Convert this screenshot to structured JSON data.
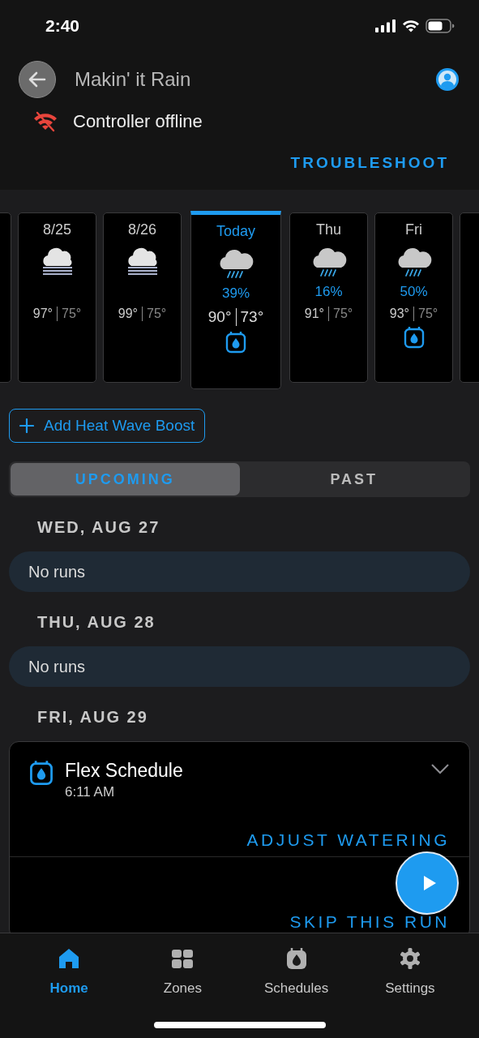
{
  "status_bar": {
    "time": "2:40"
  },
  "header": {
    "title": "Makin' it Rain",
    "status": "Controller offline",
    "action": "TROUBLESHOOT"
  },
  "forecast": [
    {
      "kind": "partial"
    },
    {
      "kind": "fog",
      "label": "8/25",
      "high": "97°",
      "low": "75°",
      "selected": false,
      "scheduled": false
    },
    {
      "kind": "fog",
      "label": "8/26",
      "high": "99°",
      "low": "75°",
      "selected": false,
      "scheduled": false
    },
    {
      "kind": "rain",
      "label": "Today",
      "chance": "39%",
      "high": "90°",
      "low": "73°",
      "selected": true,
      "scheduled": true
    },
    {
      "kind": "rain",
      "label": "Thu",
      "chance": "16%",
      "high": "91°",
      "low": "75°",
      "selected": false,
      "scheduled": false
    },
    {
      "kind": "rain",
      "label": "Fri",
      "chance": "50%",
      "high": "93°",
      "low": "75°",
      "selected": false,
      "scheduled": true
    },
    {
      "kind": "partial"
    }
  ],
  "boost_button": "Add Heat Wave Boost",
  "segments": [
    {
      "label": "UPCOMING",
      "selected": true
    },
    {
      "label": "PAST",
      "selected": false
    }
  ],
  "days": [
    {
      "heading": "WED, AUG 27",
      "empty_text": "No runs"
    },
    {
      "heading": "THU, AUG 28",
      "empty_text": "No runs"
    },
    {
      "heading": "FRI, AUG 29",
      "runs": [
        {
          "name": "Flex Schedule",
          "time": "6:11 AM",
          "expanded": false,
          "actions": [
            "ADJUST WATERING",
            "SKIP THIS RUN"
          ]
        }
      ]
    }
  ],
  "tabs": [
    {
      "label": "Home",
      "selected": true
    },
    {
      "label": "Zones",
      "selected": false
    },
    {
      "label": "Schedules",
      "selected": false
    },
    {
      "label": "Settings",
      "selected": false
    }
  ]
}
